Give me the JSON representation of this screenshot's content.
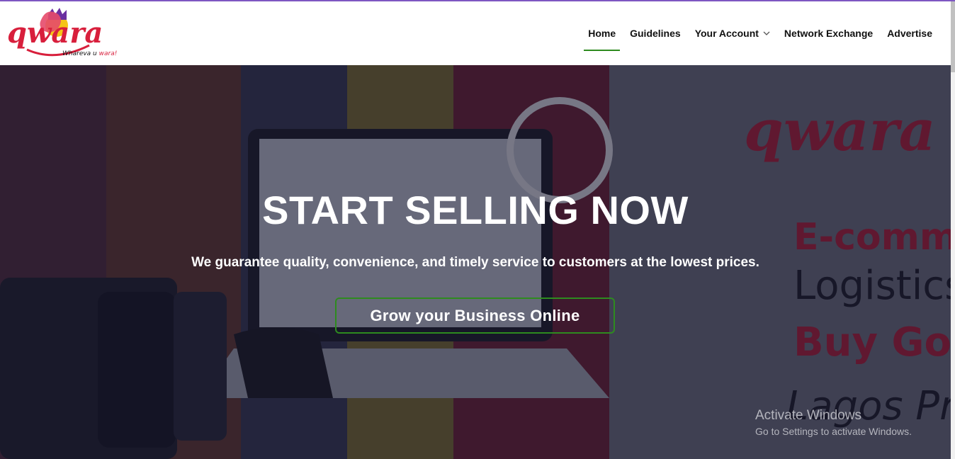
{
  "brand": {
    "logo_word": "qwara",
    "tagline_prefix": "Whareva u ",
    "tagline_highlight": "wara!",
    "colors": {
      "red": "#d81f3c",
      "yellow": "#f5c518",
      "purple": "#6b2fa0",
      "accent_green": "#2e8b1f"
    }
  },
  "nav": {
    "items": [
      {
        "label": "Home",
        "active": true
      },
      {
        "label": "Guidelines",
        "active": false
      },
      {
        "label": "Your Account",
        "active": false,
        "dropdown": true
      },
      {
        "label": "Network Exchange",
        "active": false
      },
      {
        "label": "Advertise",
        "active": false
      }
    ]
  },
  "hero": {
    "title": "START SELLING NOW",
    "subtitle": "We guarantee quality, convenience, and timely service to customers at the lowest prices.",
    "cta_label": "Grow your Business Online"
  },
  "windows_watermark": {
    "title": "Activate Windows",
    "subtitle": "Go to Settings to activate Windows."
  }
}
